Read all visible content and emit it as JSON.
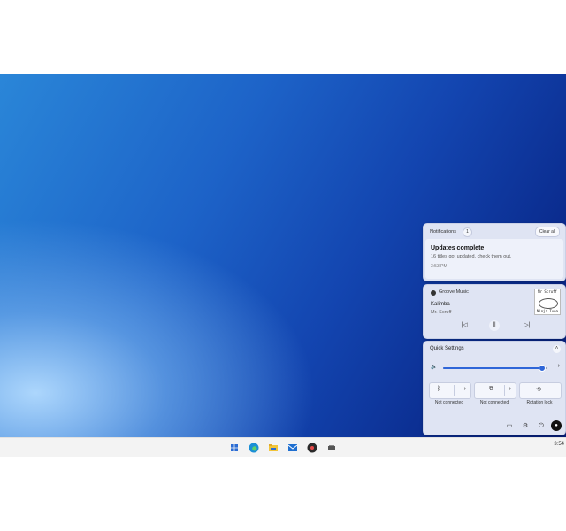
{
  "notifications": {
    "header": "Notifications",
    "count": "1",
    "clear_all": "Clear all",
    "card": {
      "title": "Updates complete",
      "body": "16 titles got updated, check them out.",
      "time": "3:53 PM"
    }
  },
  "media": {
    "app_name": "Groove Music",
    "track": "Kalimba",
    "artist": "Mr. Scruff",
    "album_art_text": [
      "Mr Scruff",
      "Ninja Tuna"
    ],
    "controls": {
      "prev_icon": "previous-track-icon",
      "pause_icon": "pause-icon",
      "next_icon": "next-track-icon"
    }
  },
  "quick_settings": {
    "title": "Quick Settings",
    "volume": {
      "level": 0.95,
      "icon": "speaker-icon"
    },
    "tiles": [
      {
        "icon": "bluetooth-icon",
        "label": "Not connected"
      },
      {
        "icon": "cast-icon",
        "label": "Not connected"
      },
      {
        "icon": "rotation-lock-icon",
        "label": "Rotation lock"
      }
    ],
    "footer": [
      "battery-icon",
      "settings-icon",
      "power-icon",
      "user-icon"
    ]
  },
  "taskbar": {
    "icons": [
      "start-icon",
      "edge-icon",
      "file-explorer-icon",
      "mail-icon",
      "groove-music-icon",
      "task-view-icon"
    ],
    "clock": "3:54"
  },
  "colors": {
    "accent": "#2f66d8",
    "panel_bg": "#dfe4f3",
    "taskbar_bg": "#f3f3f3"
  }
}
